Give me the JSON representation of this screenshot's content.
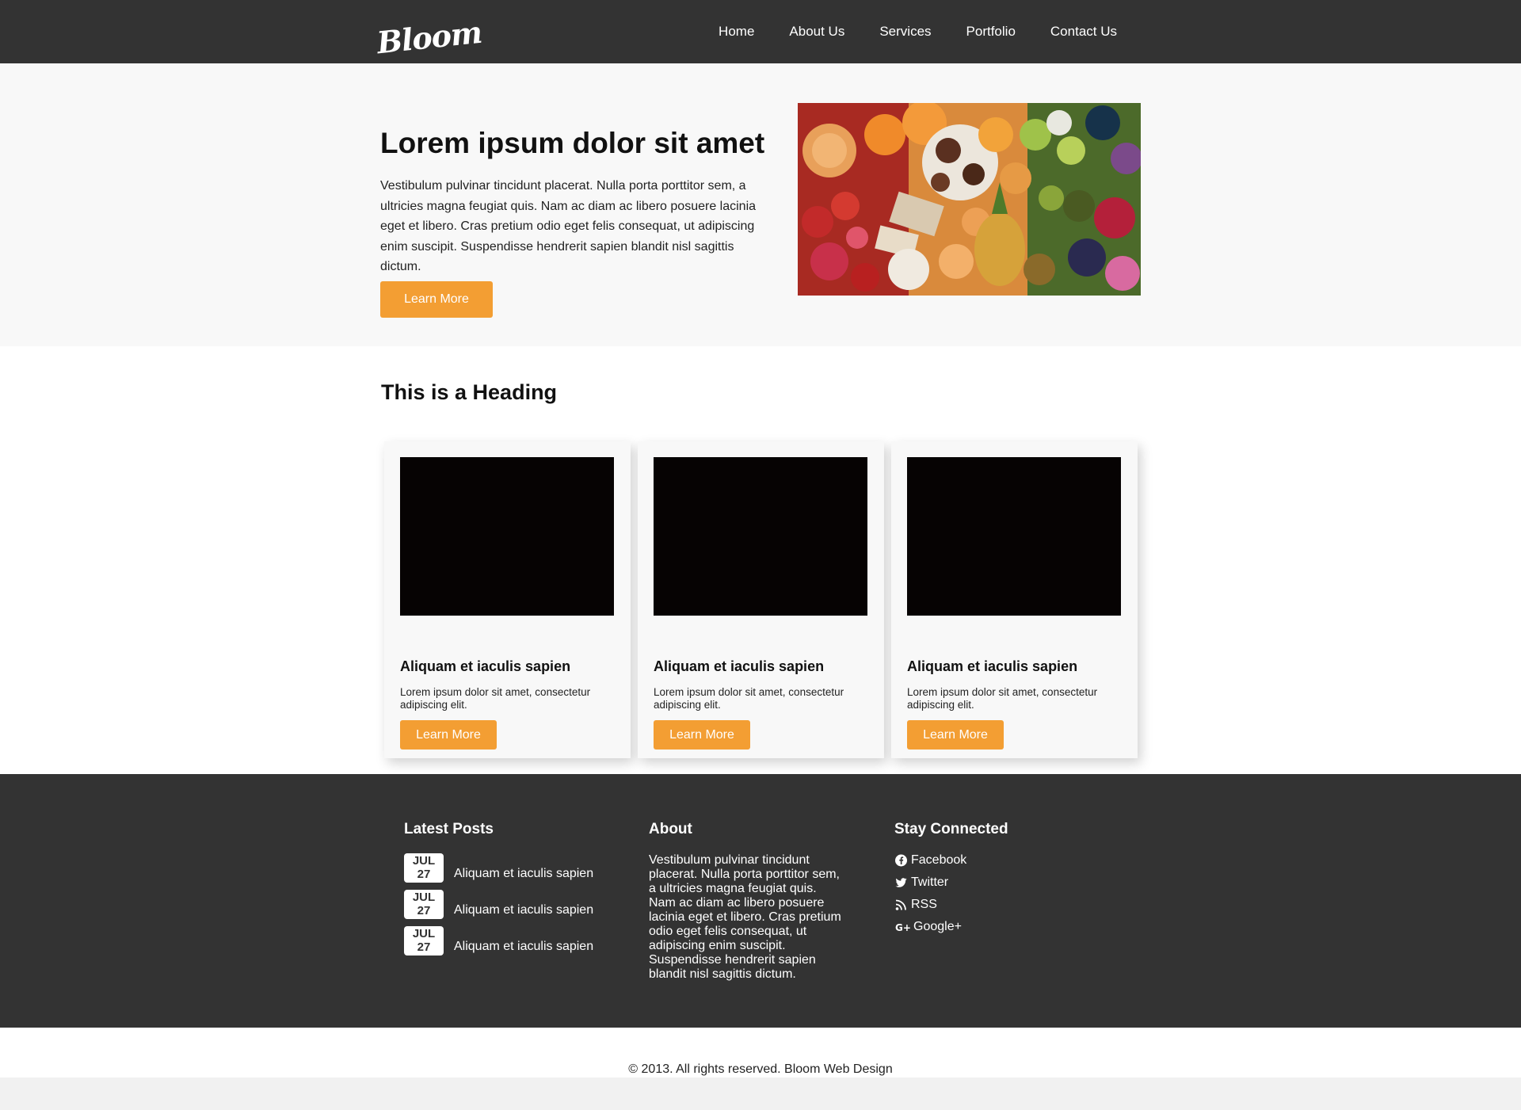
{
  "nav": {
    "logo": "Bloom",
    "items": [
      "Home",
      "About Us",
      "Services",
      "Portfolio",
      "Contact Us"
    ]
  },
  "hero": {
    "title": "Lorem ipsum dolor sit amet",
    "text": "Vestibulum pulvinar tincidunt placerat. Nulla porta porttitor sem, a ultricies magna feugiat quis. Nam ac diam ac libero posuere lacinia eget et libero. Cras pretium odio eget felis consequat, ut adipiscing enim suscipit. Suspendisse hendrerit sapien blandit nisl sagittis dictum.",
    "button": "Learn More"
  },
  "section": {
    "heading": "This is a Heading",
    "cards": [
      {
        "title": "Aliquam et iaculis sapien",
        "text": "Lorem ipsum dolor sit amet, consectetur adipiscing elit.",
        "button": "Learn More"
      },
      {
        "title": "Aliquam et iaculis sapien",
        "text": "Lorem ipsum dolor sit amet, consectetur adipiscing elit.",
        "button": "Learn More"
      },
      {
        "title": "Aliquam et iaculis sapien",
        "text": "Lorem ipsum dolor sit amet, consectetur adipiscing elit.",
        "button": "Learn More"
      }
    ]
  },
  "footer": {
    "latest_posts": {
      "heading": "Latest Posts",
      "posts": [
        {
          "month": "JUL",
          "day": "27",
          "title": "Aliquam et iaculis sapien"
        },
        {
          "month": "JUL",
          "day": "27",
          "title": "Aliquam et iaculis sapien"
        },
        {
          "month": "JUL",
          "day": "27",
          "title": "Aliquam et iaculis sapien"
        }
      ]
    },
    "about": {
      "heading": "About",
      "text": "Vestibulum pulvinar tincidunt placerat. Nulla porta porttitor sem, a ultricies magna feugiat quis. Nam ac diam ac libero posuere lacinia eget et libero. Cras pretium odio eget felis consequat, ut adipiscing enim suscipit. Suspendisse hendrerit sapien blandit nisl sagittis dictum."
    },
    "social": {
      "heading": "Stay Connected",
      "links": [
        {
          "label": "Facebook",
          "icon": "facebook-icon"
        },
        {
          "label": "Twitter",
          "icon": "twitter-icon"
        },
        {
          "label": "RSS",
          "icon": "rss-icon"
        },
        {
          "label": "Google+",
          "icon": "google-plus-icon"
        }
      ]
    }
  },
  "copyright": "© 2013. All rights reserved. Bloom Web Design",
  "colors": {
    "nav_bg": "#333333",
    "accent": "#f39e33",
    "hero_bg": "#f8f8f8",
    "footer_bg": "#333333"
  }
}
